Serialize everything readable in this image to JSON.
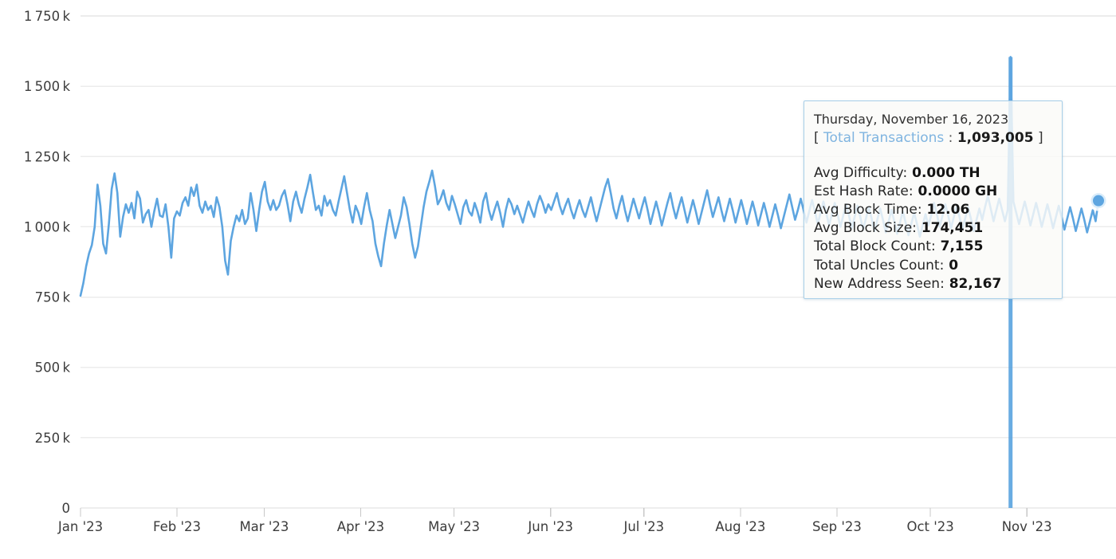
{
  "chart_data": {
    "type": "line",
    "title": "",
    "xlabel": "",
    "ylabel": "",
    "grid": true,
    "legend_position": "none",
    "line_color": "#5da5e0",
    "x_tick_labels": [
      "Jan '23",
      "Feb '23",
      "Mar '23",
      "Apr '23",
      "May '23",
      "Jun '23",
      "Jul '23",
      "Aug '23",
      "Sep '23",
      "Oct '23",
      "Nov '23"
    ],
    "y_tick_labels": [
      "0",
      "250 k",
      "500 k",
      "750 k",
      "1 000 k",
      "1 250 k",
      "1 500 k",
      "1 750 k"
    ],
    "y_tick_values": [
      0,
      250000,
      500000,
      750000,
      1000000,
      1250000,
      1500000,
      1750000
    ],
    "ylim": [
      0,
      1750000
    ],
    "xlim": [
      "2023-01-01",
      "2023-11-23"
    ],
    "series": [
      {
        "name": "Total Transactions",
        "values": [
          755000,
          800000,
          860000,
          905000,
          935000,
          1000000,
          1150000,
          1075000,
          940000,
          905000,
          1010000,
          1135000,
          1190000,
          1120000,
          965000,
          1035000,
          1080000,
          1050000,
          1085000,
          1030000,
          1125000,
          1100000,
          1015000,
          1045000,
          1060000,
          1000000,
          1055000,
          1100000,
          1040000,
          1035000,
          1080000,
          1000000,
          890000,
          1030000,
          1055000,
          1040000,
          1085000,
          1105000,
          1075000,
          1140000,
          1110000,
          1150000,
          1075000,
          1050000,
          1090000,
          1060000,
          1075000,
          1035000,
          1105000,
          1070000,
          1000000,
          880000,
          830000,
          950000,
          1000000,
          1040000,
          1020000,
          1060000,
          1010000,
          1030000,
          1120000,
          1060000,
          985000,
          1060000,
          1125000,
          1160000,
          1090000,
          1060000,
          1095000,
          1060000,
          1075000,
          1110000,
          1130000,
          1080000,
          1020000,
          1090000,
          1125000,
          1080000,
          1050000,
          1100000,
          1140000,
          1185000,
          1120000,
          1060000,
          1075000,
          1040000,
          1110000,
          1075000,
          1095000,
          1060000,
          1040000,
          1090000,
          1135000,
          1180000,
          1120000,
          1060000,
          1015000,
          1075000,
          1050000,
          1010000,
          1070000,
          1120000,
          1060000,
          1020000,
          940000,
          895000,
          860000,
          940000,
          1005000,
          1060000,
          1010000,
          960000,
          1000000,
          1040000,
          1105000,
          1070000,
          1010000,
          940000,
          890000,
          930000,
          1000000,
          1070000,
          1125000,
          1160000,
          1200000,
          1145000,
          1080000,
          1100000,
          1130000,
          1085000,
          1060000,
          1110000,
          1080000,
          1045000,
          1010000,
          1070000,
          1095000,
          1055000,
          1040000,
          1085000,
          1055000,
          1015000,
          1090000,
          1120000,
          1060000,
          1025000,
          1060000,
          1090000,
          1050000,
          1000000,
          1060000,
          1100000,
          1080000,
          1045000,
          1075000,
          1045000,
          1015000,
          1055000,
          1090000,
          1060000,
          1035000,
          1080000,
          1110000,
          1085000,
          1050000,
          1080000,
          1060000,
          1090000,
          1120000,
          1075000,
          1045000,
          1075000,
          1100000,
          1060000,
          1030000,
          1065000,
          1095000,
          1060000,
          1035000,
          1070000,
          1105000,
          1060000,
          1020000,
          1060000,
          1100000,
          1140000,
          1170000,
          1120000,
          1065000,
          1030000,
          1075000,
          1110000,
          1060000,
          1020000,
          1060000,
          1100000,
          1065000,
          1030000,
          1070000,
          1105000,
          1060000,
          1010000,
          1050000,
          1090000,
          1050000,
          1005000,
          1045000,
          1085000,
          1120000,
          1070000,
          1030000,
          1070000,
          1105000,
          1060000,
          1015000,
          1055000,
          1095000,
          1055000,
          1010000,
          1050000,
          1090000,
          1130000,
          1080000,
          1035000,
          1070000,
          1105000,
          1060000,
          1020000,
          1060000,
          1100000,
          1060000,
          1015000,
          1055000,
          1095000,
          1055000,
          1010000,
          1050000,
          1090000,
          1050000,
          1005000,
          1045000,
          1085000,
          1045000,
          1000000,
          1040000,
          1080000,
          1040000,
          995000,
          1035000,
          1075000,
          1115000,
          1070000,
          1025000,
          1060000,
          1100000,
          1060000,
          1015000,
          1055000,
          1095000,
          1055000,
          1010000,
          1050000,
          1090000,
          1050000,
          1005000,
          1045000,
          1085000,
          1045000,
          1000000,
          1040000,
          1080000,
          1040000,
          995000,
          1035000,
          1075000,
          1035000,
          990000,
          1030000,
          1070000,
          1030000,
          985000,
          1025000,
          1065000,
          1025000,
          980000,
          1020000,
          1060000,
          1020000,
          975000,
          1015000,
          1055000,
          1015000,
          970000,
          1010000,
          1050000,
          1010000,
          965000,
          1005000,
          1045000,
          1005000,
          1040000,
          1085000,
          1045000,
          1000000,
          1040000,
          1080000,
          1040000,
          995000,
          1035000,
          1075000,
          1035000,
          990000,
          1030000,
          1070000,
          1030000,
          985000,
          1025000,
          1065000,
          1025000,
          1070000,
          1110000,
          1065000,
          1020000,
          1060000,
          1100000,
          1060000,
          1020000,
          1060000,
          1604000,
          1090000,
          1050000,
          1010000,
          1050000,
          1090000,
          1050000,
          1005000,
          1045000,
          1085000,
          1045000,
          1000000,
          1040000,
          1080000,
          1040000,
          995000,
          1035000,
          1075000,
          1035000,
          990000,
          1030000,
          1070000,
          1030000,
          985000,
          1025000,
          1065000,
          1025000,
          980000,
          1020000,
          1060000,
          1020000,
          1093005
        ]
      }
    ],
    "highlight": {
      "date": "Thursday, November 16, 2023",
      "series_label": "Total Transactions",
      "value": "1,093,005"
    }
  },
  "tooltip": {
    "date": "Thursday, November 16, 2023",
    "bracket_open": "[",
    "bracket_close": "]",
    "series_label": "Total Transactions",
    "colon": ":",
    "total_transactions": "1,093,005",
    "rows": [
      {
        "label": "Avg Difficulty:",
        "value": "0.000 TH"
      },
      {
        "label": "Est Hash Rate:",
        "value": "0.0000 GH"
      },
      {
        "label": "Avg Block Time:",
        "value": "12.06"
      },
      {
        "label": "Avg Block Size:",
        "value": "174,451"
      },
      {
        "label": "Total Block Count:",
        "value": "7,155"
      },
      {
        "label": "Total Uncles Count:",
        "value": "0"
      },
      {
        "label": "New Address Seen:",
        "value": "82,167"
      }
    ]
  }
}
